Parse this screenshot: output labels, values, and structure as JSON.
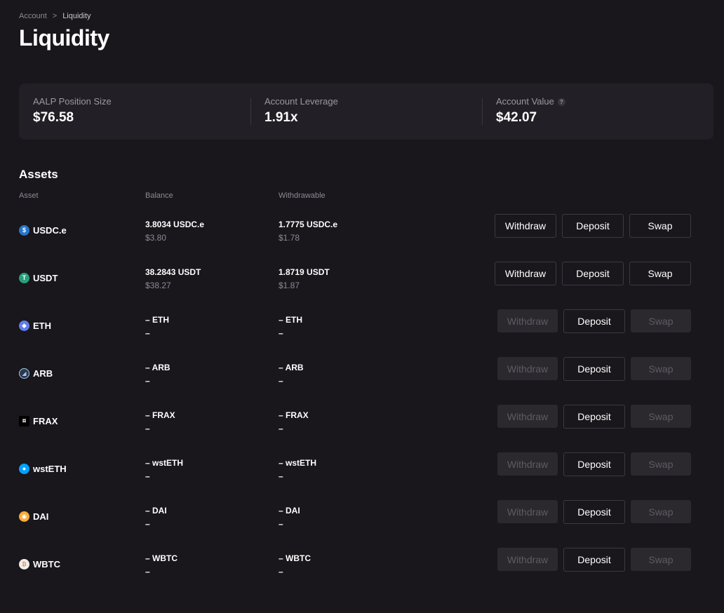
{
  "breadcrumb": {
    "parent": "Account",
    "separator": ">",
    "current": "Liquidity"
  },
  "page_title": "Liquidity",
  "summary": [
    {
      "label": "AALP Position Size",
      "value": "$76.58",
      "help": false
    },
    {
      "label": "Account Leverage",
      "value": "1.91x",
      "help": false
    },
    {
      "label": "Account Value",
      "value": "$42.07",
      "help": true,
      "help_glyph": "?"
    }
  ],
  "assets_section": {
    "title": "Assets",
    "headers": {
      "asset": "Asset",
      "balance": "Balance",
      "withdrawable": "Withdrawable"
    },
    "rows": [
      {
        "asset": "USDC.e",
        "icon": "usdc-icon",
        "icon_glyph": "$",
        "balance": "3.8034 USDC.e",
        "balance_usd": "$3.80",
        "withdrawable": "1.7775 USDC.e",
        "withdrawable_usd": "$1.78",
        "enabled": true
      },
      {
        "asset": "USDT",
        "icon": "usdt-icon",
        "icon_glyph": "T",
        "balance": "38.2843 USDT",
        "balance_usd": "$38.27",
        "withdrawable": "1.8719 USDT",
        "withdrawable_usd": "$1.87",
        "enabled": true
      },
      {
        "asset": "ETH",
        "icon": "eth-icon",
        "icon_glyph": "◆",
        "balance": "– ETH",
        "balance_usd": "–",
        "withdrawable": "– ETH",
        "withdrawable_usd": "–",
        "enabled": false
      },
      {
        "asset": "ARB",
        "icon": "arb-icon",
        "icon_glyph": "◢",
        "balance": "– ARB",
        "balance_usd": "–",
        "withdrawable": "– ARB",
        "withdrawable_usd": "–",
        "enabled": false
      },
      {
        "asset": "FRAX",
        "icon": "frax-icon",
        "icon_glyph": "¤",
        "balance": "– FRAX",
        "balance_usd": "–",
        "withdrawable": "– FRAX",
        "withdrawable_usd": "–",
        "enabled": false
      },
      {
        "asset": "wstETH",
        "icon": "wsteth-icon",
        "icon_glyph": "●",
        "balance": "– wstETH",
        "balance_usd": "–",
        "withdrawable": "– wstETH",
        "withdrawable_usd": "–",
        "enabled": false
      },
      {
        "asset": "DAI",
        "icon": "dai-icon",
        "icon_glyph": "◉",
        "balance": "– DAI",
        "balance_usd": "–",
        "withdrawable": "– DAI",
        "withdrawable_usd": "–",
        "enabled": false
      },
      {
        "asset": "WBTC",
        "icon": "wbtc-icon",
        "icon_glyph": "₿",
        "balance": "– WBTC",
        "balance_usd": "–",
        "withdrawable": "– WBTC",
        "withdrawable_usd": "–",
        "enabled": false
      }
    ]
  },
  "actions": {
    "withdraw": "Withdraw",
    "deposit": "Deposit",
    "swap": "Swap"
  },
  "colors": {
    "background": "#19161c",
    "card": "#231f26",
    "muted_text": "#8e8a93",
    "button_border": "#3d3941",
    "disabled_button": "#2b282e"
  }
}
